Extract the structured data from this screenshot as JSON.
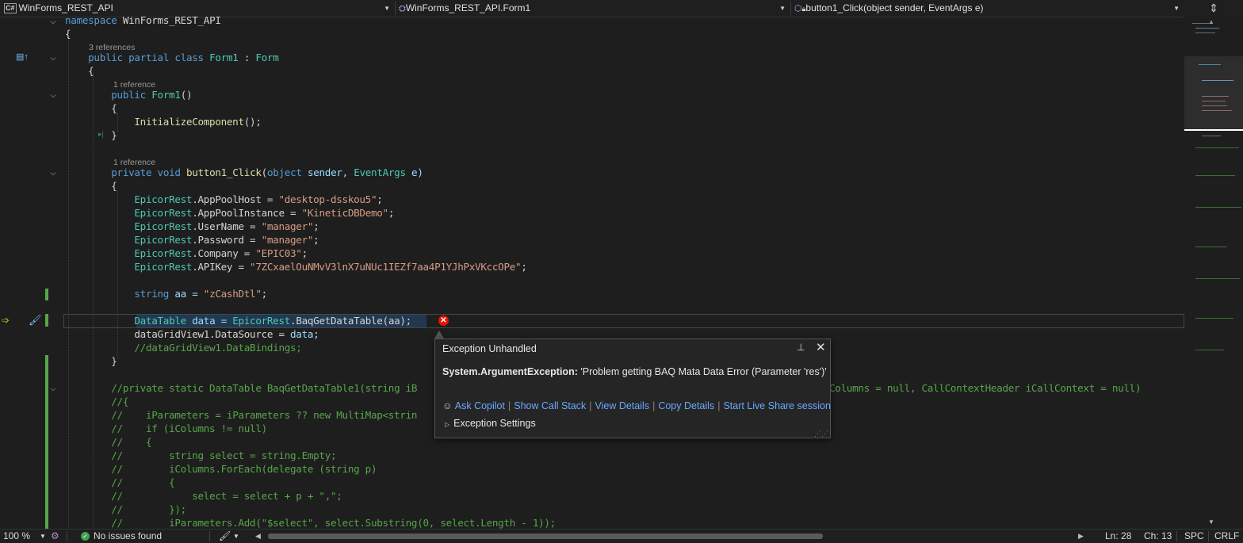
{
  "navbar": {
    "project_badge": "C#",
    "project": "WinForms_REST_API",
    "class": "WinForms_REST_API.Form1",
    "member": "button1_Click(object sender, EventArgs e)"
  },
  "codelens": {
    "class_refs": "3 references",
    "ctor_refs": "1 reference",
    "method_refs": "1 reference"
  },
  "code": {
    "namespace_kw": "namespace",
    "namespace_name": "WinForms_REST_API",
    "open_brace": "{",
    "close_brace": "}",
    "class_line_kw1": "public",
    "class_line_kw2": "partial",
    "class_line_kw3": "class",
    "class_name": "Form1",
    "class_colon": " : ",
    "class_base": "Form",
    "ctor_kw": "public",
    "ctor_name": "Form1",
    "ctor_parens": "()",
    "init_call": "InitializeComponent",
    "init_tail": "();",
    "method_kw1": "private",
    "method_kw2": "void",
    "method_name": "button1_Click",
    "method_p1": "(",
    "method_t1": "object",
    "method_n1": " sender, ",
    "method_t2": "EventArgs",
    "method_n2": " e)",
    "assign1_type": "EpicorRest",
    "assign1_prop": ".AppPoolHost = ",
    "assign1_val": "\"desktop-dsskou5\"",
    "assign2_type": "EpicorRest",
    "assign2_prop": ".AppPoolInstance = ",
    "assign2_val": "\"KineticDBDemo\"",
    "assign3_type": "EpicorRest",
    "assign3_prop": ".UserName = ",
    "assign3_val": "\"manager\"",
    "assign4_type": "EpicorRest",
    "assign4_prop": ".Password = ",
    "assign4_val": "\"manager\"",
    "assign5_type": "EpicorRest",
    "assign5_prop": ".Company = ",
    "assign5_val": "\"EPIC03\"",
    "assign6_type": "EpicorRest",
    "assign6_prop": ".APIKey = ",
    "assign6_val": "\"7ZCxaelOuNMvV3lnX7uNUc1IEZf7aa4P1YJhPxVKccOPe\"",
    "semi": ";",
    "string_kw": "string",
    "aa_decl": " aa = ",
    "aa_val": "\"zCashDtl\"",
    "dt_type": "DataTable",
    "dt_mid": " data = ",
    "dt_cls": "EpicorRest",
    "dt_call": ".BaqGetDataTable(aa);",
    "dgv_line": "dataGridView1.DataSource = ",
    "dgv_data": "data",
    "dgv_comment": "//dataGridView1.DataBindings;",
    "c1": "//private static DataTable BaqGetDataTable1(string iB",
    "c1_right": "Columns = null, CallContextHeader iCallContext = null)",
    "c2": "//{",
    "c3": "//    iParameters = iParameters ?? new MultiMap<strin",
    "c4": "//    if (iColumns != null)",
    "c5": "//    {",
    "c6": "//        string select = string.Empty;",
    "c7": "//        iColumns.ForEach(delegate (string p)",
    "c8": "//        {",
    "c9": "//            select = select + p + \",\";",
    "c10": "//        });",
    "c11": "//        iParameters.Add(\"$select\", select.Substring(0, select.Length - 1));"
  },
  "exception": {
    "title": "Exception Unhandled",
    "type": "System.ArgumentException:",
    "message": " 'Problem getting BAQ Mata Data Error (Parameter 'res')'",
    "actions": [
      "Ask Copilot",
      "Show Call Stack",
      "View Details",
      "Copy Details",
      "Start Live Share session"
    ],
    "settings": "Exception Settings"
  },
  "status": {
    "zoom": "100 %",
    "issues": "No issues found",
    "line": "Ln: 28",
    "col": "Ch: 13",
    "whitespace": "SPC",
    "eol": "CRLF"
  },
  "colors": {
    "keyword": "#569cd6",
    "type": "#4ec9b0",
    "string": "#d69d85",
    "comment": "#57a64a",
    "error": "#e51400",
    "link": "#6aa8ff"
  }
}
